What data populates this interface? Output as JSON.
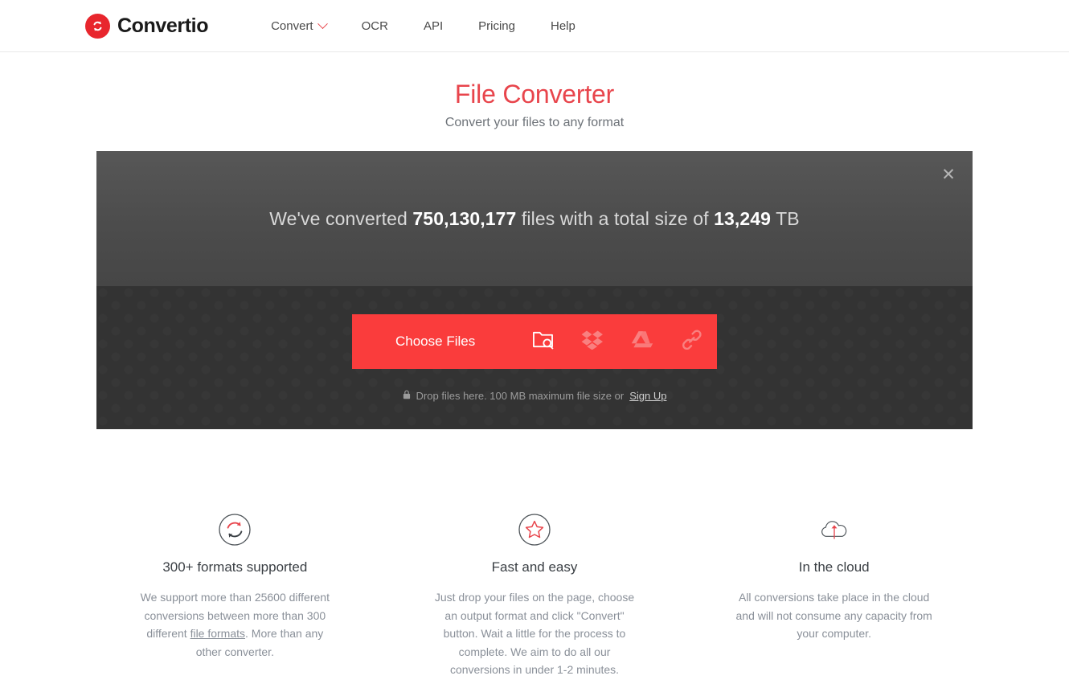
{
  "brand": {
    "name": "Convertio",
    "logo_icon": "convertio-loop-icon",
    "logo_color": "#e8262d"
  },
  "nav": {
    "items": [
      {
        "label": "Convert",
        "has_dropdown": true,
        "icon": "chevron-down-icon"
      },
      {
        "label": "OCR",
        "has_dropdown": false
      },
      {
        "label": "API",
        "has_dropdown": false
      },
      {
        "label": "Pricing",
        "has_dropdown": false
      },
      {
        "label": "Help",
        "has_dropdown": false
      }
    ]
  },
  "hero": {
    "title": "File Converter",
    "subtitle": "Convert your files to any format",
    "title_color": "#e8454c"
  },
  "stats": {
    "prefix": "We've converted ",
    "files_count": "750,130,177",
    "middle": " files with a total size of ",
    "total_size": "13,249",
    "suffix": " TB",
    "close_icon": "close-icon",
    "close_glyph": "✕"
  },
  "dropzone": {
    "choose_files_label": "Choose Files",
    "sources": [
      {
        "name": "local-folder",
        "icon": "folder-search-icon"
      },
      {
        "name": "dropbox",
        "icon": "dropbox-icon"
      },
      {
        "name": "google-drive",
        "icon": "google-drive-icon"
      },
      {
        "name": "url-link",
        "icon": "link-icon"
      }
    ],
    "lock_icon": "lock-icon",
    "note_text": "Drop files here. 100 MB maximum file size or ",
    "signup_label": "Sign Up",
    "button_color": "#fa3c3c"
  },
  "features": [
    {
      "icon": "refresh-circle-icon",
      "title": "300+ formats supported",
      "desc_part1": "We support more than 25600 different conversions between more than 300 different ",
      "link_label": "file formats",
      "desc_part2": ". More than any other converter."
    },
    {
      "icon": "star-circle-icon",
      "title": "Fast and easy",
      "desc_part1": "Just drop your files on the page, choose an output format and click \"Convert\" button. Wait a little for the process to complete. We aim to do all our conversions in under 1-2 minutes.",
      "link_label": "",
      "desc_part2": ""
    },
    {
      "icon": "cloud-upload-icon",
      "title": "In the cloud",
      "desc_part1": "All conversions take place in the cloud and will not consume any capacity from your computer.",
      "link_label": "",
      "desc_part2": ""
    }
  ]
}
